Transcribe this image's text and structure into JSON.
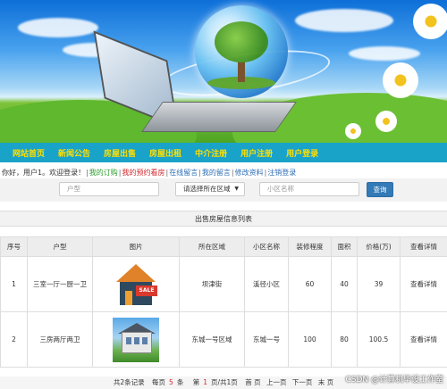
{
  "nav": {
    "items": [
      "网站首页",
      "新闻公告",
      "房屋出售",
      "房屋出租",
      "中介注册",
      "用户注册",
      "用户登录"
    ]
  },
  "welcome": {
    "greeting": "你好，用户1。欢迎登录！",
    "links": [
      {
        "label": "我的订购",
        "color": "green"
      },
      {
        "label": "我的预约看房",
        "color": "red"
      },
      {
        "label": "在线留言",
        "color": "blue"
      },
      {
        "label": "我的留言",
        "color": "blue"
      },
      {
        "label": "修改资料",
        "color": "blue"
      },
      {
        "label": "注销登录",
        "color": "blue"
      }
    ]
  },
  "search": {
    "house_type_placeholder": "户型",
    "area_select": "请选择所在区域",
    "community_placeholder": "小区名称",
    "button": "查询"
  },
  "table": {
    "title": "出售房屋信息列表",
    "headers": [
      "序号",
      "户型",
      "图片",
      "所在区域",
      "小区名称",
      "装修程度",
      "面积",
      "价格(万)",
      "查看详情"
    ],
    "rows": [
      {
        "no": "1",
        "type": "三室一厅一厨一卫",
        "image": "house-for-sale-icon",
        "sale_label": "SALE",
        "area": "坝津街",
        "community": "溪径小区",
        "decoration": "60",
        "size": "40",
        "price": "39",
        "detail": "查看详情"
      },
      {
        "no": "2",
        "type": "三房两厅两卫",
        "image": "villa-photo",
        "area": "东城一号区域",
        "community": "东城一号",
        "decoration": "100",
        "size": "80",
        "price": "100.5",
        "detail": "查看详情"
      }
    ]
  },
  "pager": {
    "total": "共2条记录",
    "per_page_prefix": "每页",
    "per_page_value": "5",
    "per_page_suffix": "条",
    "page_prefix": "第",
    "page_current": "1",
    "page_suffix": "页/共1页",
    "first": "首 页",
    "prev": "上一页",
    "next": "下一页",
    "last": "末 页"
  },
  "watermark": "CSDN @计算机毕设工作室",
  "colors": {
    "nav_bg": "#1aa3c9",
    "nav_text": "#ffe000",
    "button": "#337ab7"
  }
}
